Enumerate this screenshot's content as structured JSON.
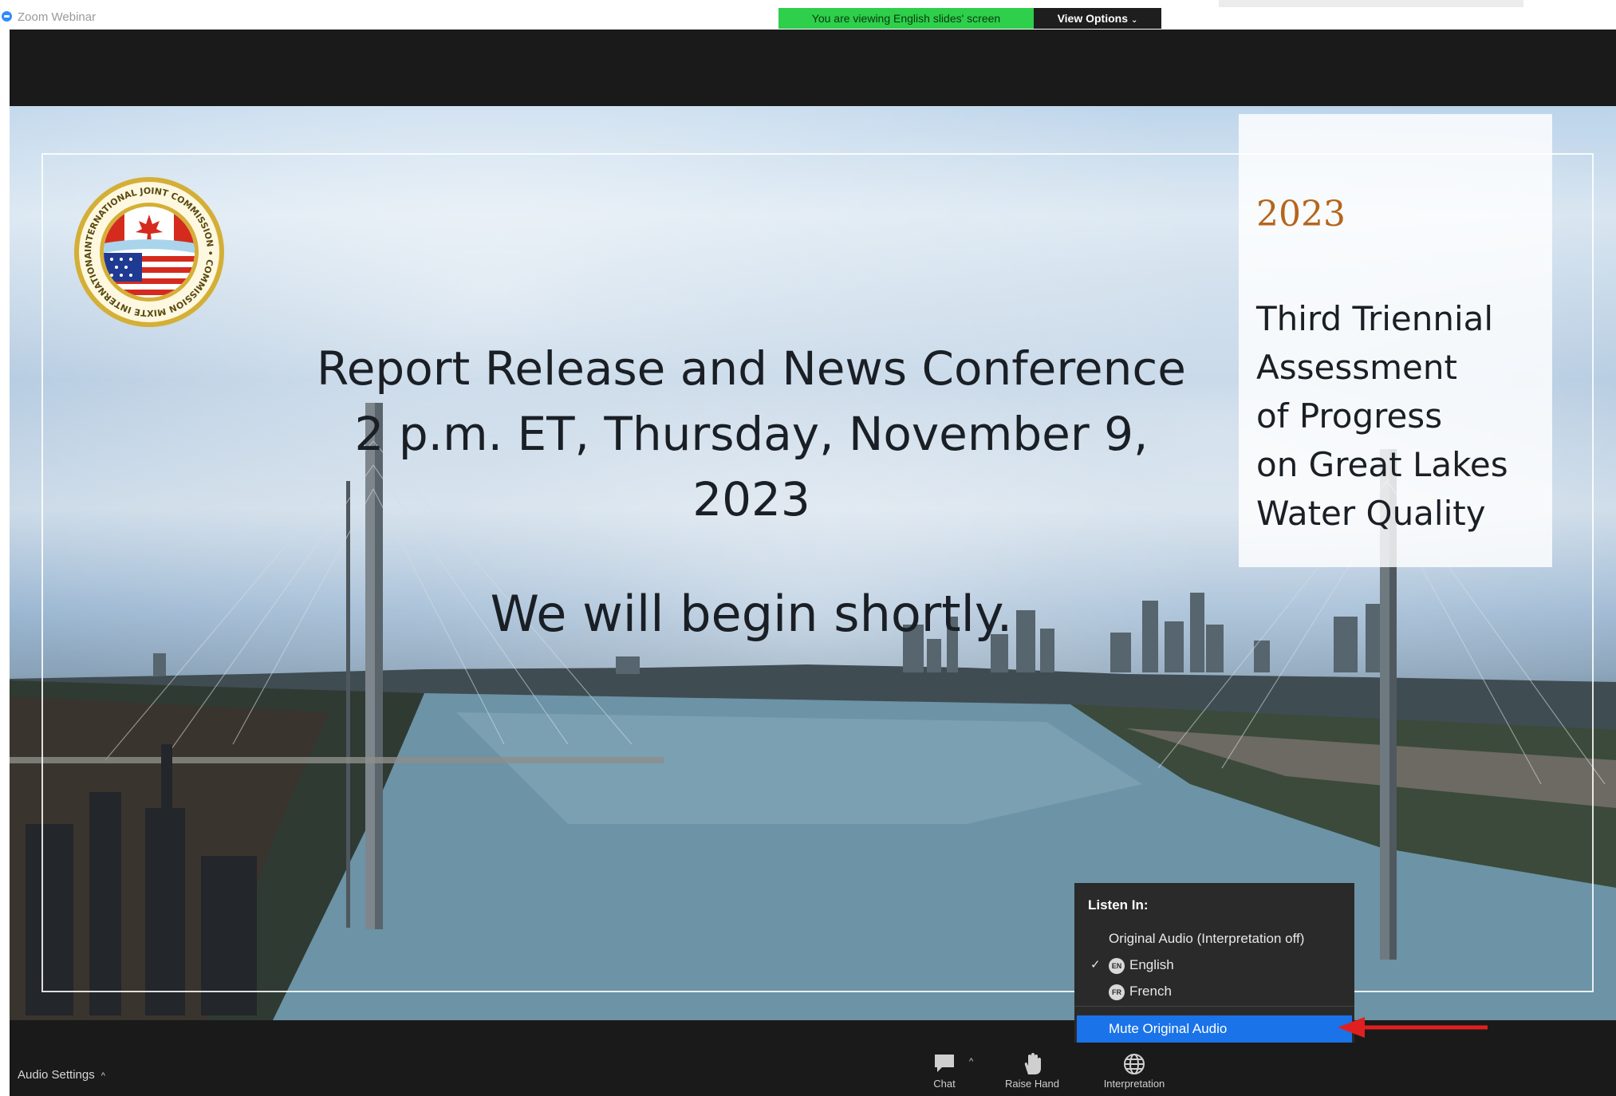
{
  "window": {
    "title": "Zoom Webinar"
  },
  "banner": {
    "viewing_text": "You are viewing English slides' screen",
    "view_options_label": "View Options"
  },
  "slide": {
    "headline_lines": [
      "Report Release and News Conference",
      "2 p.m. ET, Thursday, November 9,",
      "2023"
    ],
    "subline": "We will begin shortly.",
    "side_panel": {
      "year": "2023",
      "lines": [
        "Third Triennial",
        "Assessment",
        "of Progress",
        "on Great Lakes",
        "Water Quality"
      ]
    },
    "logo_ring_text": "INTERNATIONAL JOINT COMMISSION • COMMISSION MIXTE INTERNATIONALE"
  },
  "interpretation_menu": {
    "header": "Listen In:",
    "items": [
      {
        "label": "Original Audio (Interpretation off)",
        "badge": "",
        "checked": false
      },
      {
        "label": "English",
        "badge": "EN",
        "checked": true
      },
      {
        "label": "French",
        "badge": "FR",
        "checked": false
      }
    ],
    "mute_label": "Mute Original Audio"
  },
  "toolbar": {
    "audio_settings_label": "Audio Settings",
    "chat_label": "Chat",
    "raise_hand_label": "Raise Hand",
    "interpretation_label": "Interpretation"
  },
  "colors": {
    "zoom_blue": "#2d8cff",
    "banner_green": "#2ecf4a",
    "highlight_blue": "#1a73e8",
    "year_orange": "#b5651d",
    "arrow_red": "#e02020"
  },
  "icons": {
    "app": "zoom-logo-icon",
    "chat": "chat-bubble-icon",
    "raise_hand": "hand-icon",
    "interpretation": "globe-icon",
    "arrow": "red-arrow-annotation"
  }
}
